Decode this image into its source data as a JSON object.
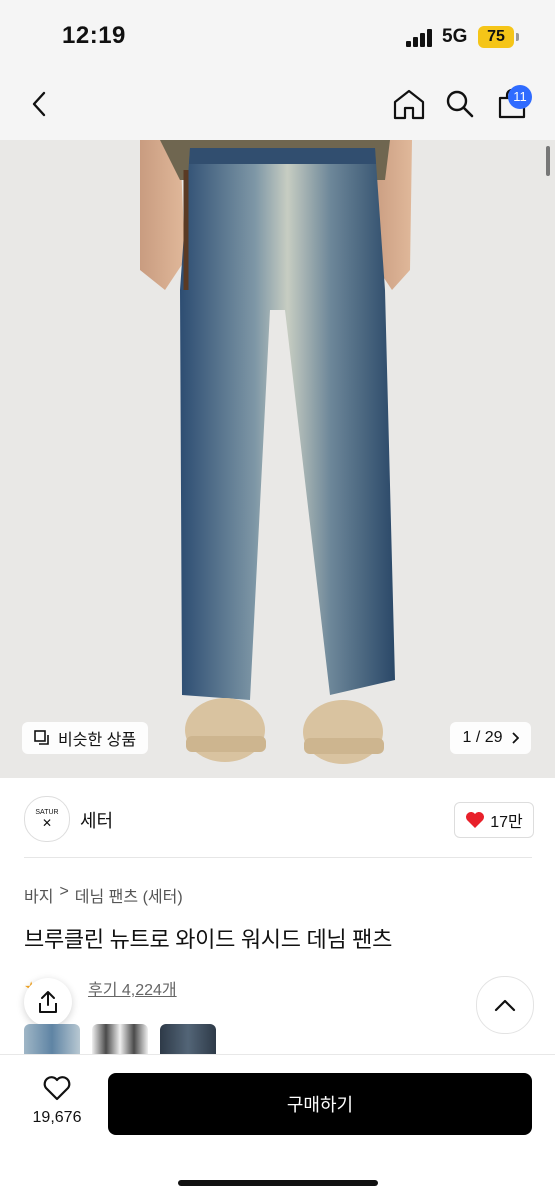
{
  "status": {
    "time": "12:19",
    "network": "5G",
    "battery": "75"
  },
  "nav": {
    "cart_count": "11"
  },
  "hero": {
    "similar_label": "비슷한 상품",
    "counter": "1 / 29"
  },
  "brand": {
    "logo_text": "SATUR",
    "name": "세터",
    "likes": "17만"
  },
  "breadcrumb": [
    "바지",
    "데님 팬츠 (세터)"
  ],
  "product": {
    "title": "브루클린 뉴트로 와이드 워시드 데님 팬츠",
    "review_label": "후기 4,224개"
  },
  "bottom": {
    "wish_count": "19,676",
    "buy_label": "구매하기"
  },
  "colors": {
    "accent": "#2f6bff",
    "like": "#e8202a",
    "battery": "#f5c518",
    "buy": "#000000"
  }
}
